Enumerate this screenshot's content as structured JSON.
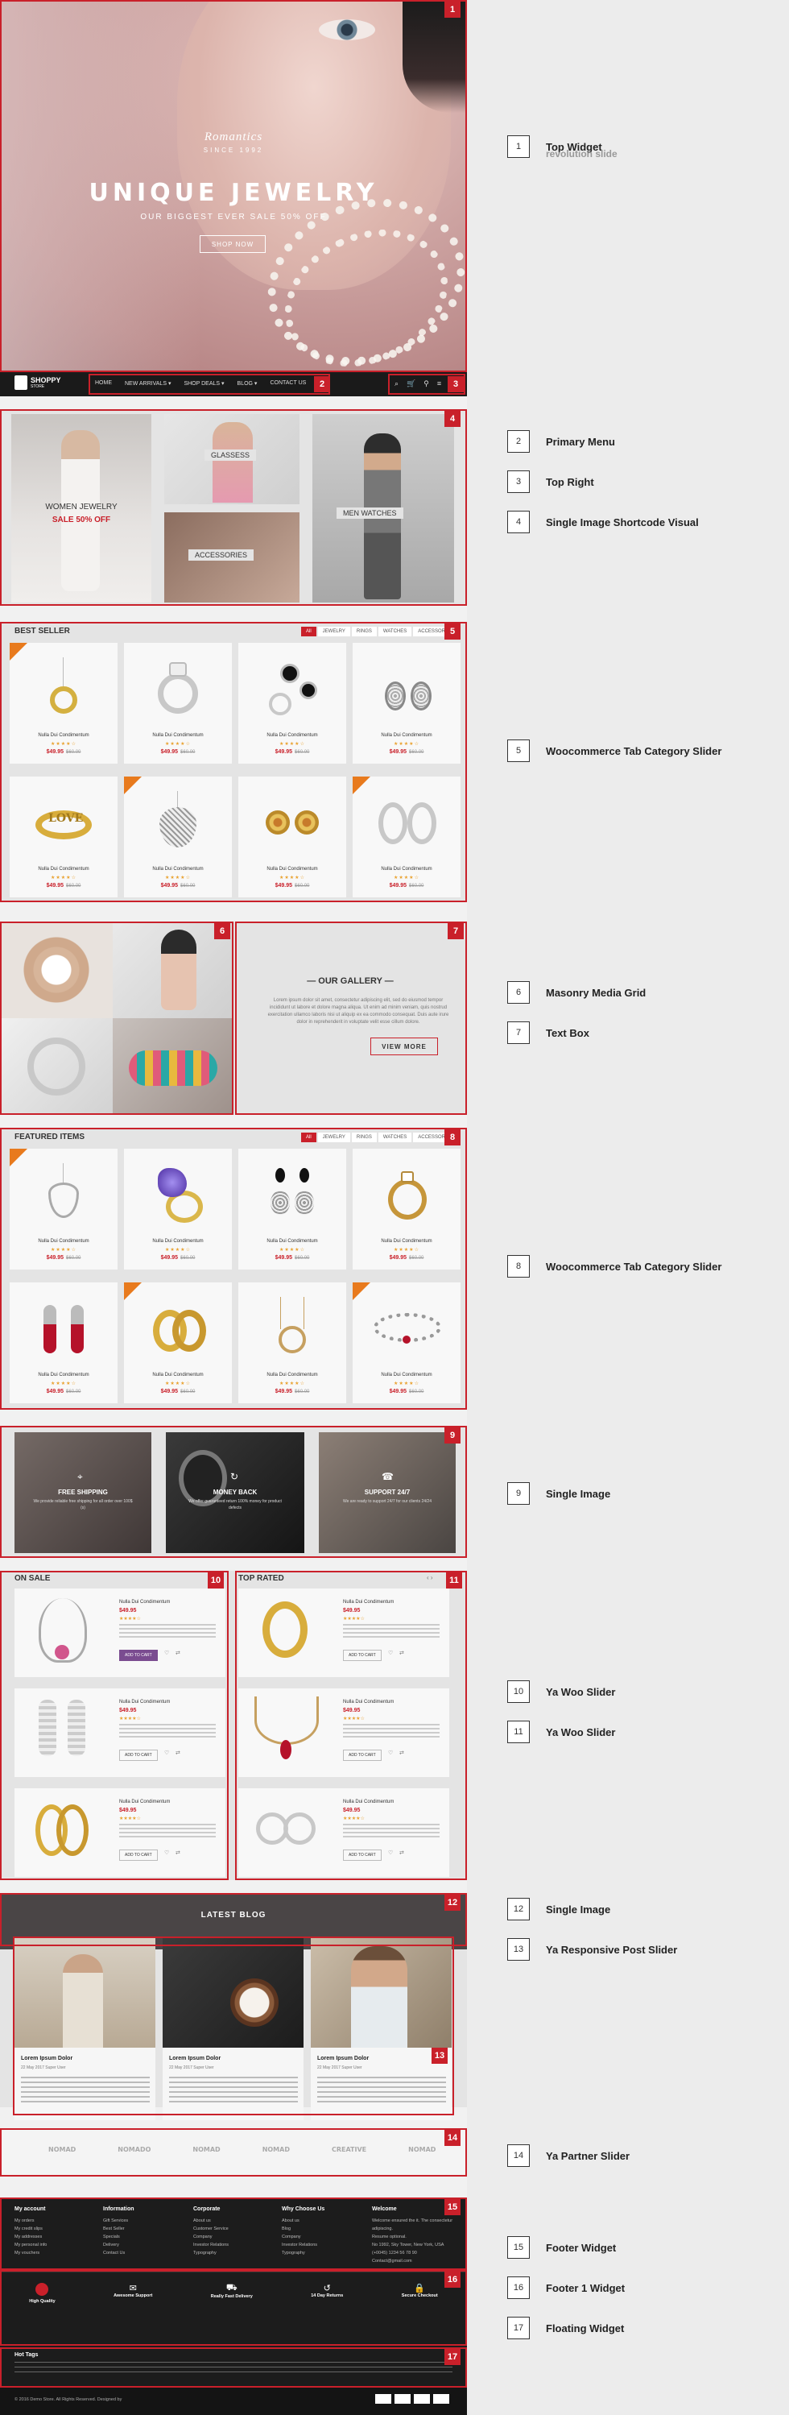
{
  "hero": {
    "script_title": "Romantics",
    "since": "SINCE 1992",
    "title": "UNIQUE JEWELRY",
    "subtitle": "OUR BIGGEST EVER SALE 50% OFF",
    "button": "SHOP NOW"
  },
  "header": {
    "logo": "SHOPPY",
    "logo_sub": "STORE",
    "nav": [
      "HOME",
      "NEW ARRIVALS ▾",
      "SHOP DEALS ▾",
      "BLOG ▾",
      "CONTACT US"
    ]
  },
  "banners": {
    "women": "WOMEN JEWELRY",
    "women_sale": "SALE 50% OFF",
    "glasses": "GLASSESS",
    "accessories": "ACCESSORIES",
    "men": "MEN WATCHES"
  },
  "bestseller": {
    "title": "BEST SELLER",
    "tabs": [
      "All",
      "JEWELRY",
      "RINGS",
      "WATCHES",
      "ACCESSORIES"
    ],
    "product_name": "Nulla Dui Condimentum",
    "stars": "★★★★☆",
    "price": "$49.95",
    "old_price": "$60.00"
  },
  "gallery": {
    "title": "OUR GALLERY",
    "text": "Lorem ipsum dolor sit amet, consectetur adipiscing elit, sed do eiusmod tempor incididunt ut labore et dolore magna aliqua. Ut enim ad minim veniam, quis nostrud exercitation ullamco laboris nisi ut aliquip ex ea commodo consequat. Duis aute irure dolor in reprehenderit in voluptate velit esse cillum dolore.",
    "button": "VIEW MORE"
  },
  "featured": {
    "title": "FEATURED ITEMS",
    "tabs": [
      "All",
      "JEWELRY",
      "RINGS",
      "WATCHES",
      "ACCESSORIES"
    ]
  },
  "services": [
    {
      "title": "FREE SHIPPING",
      "desc": "We provide reliable free shipping for all order over 100$ (s)"
    },
    {
      "title": "MONEY BACK",
      "desc": "We offer guaranteed return 100% money for product defects"
    },
    {
      "title": "SUPPORT 24/7",
      "desc": "We are ready to support 24/7 for our clients 24/24"
    }
  ],
  "onsale": {
    "title": "ON SALE",
    "add_to_cart": "ADD TO CART"
  },
  "toprated": {
    "title": "TOP RATED"
  },
  "blog": {
    "title": "LATEST BLOG",
    "post_title": "Lorem Ipsum Dolor",
    "meta": "22 May 2017   Super User"
  },
  "partners": [
    "NOMAD",
    "NOMADO",
    "NOMAD",
    "NOMAD",
    "CREATIVE",
    "NOMAD"
  ],
  "footer": {
    "cols": [
      {
        "title": "My account",
        "items": [
          "My orders",
          "My credit slips",
          "My addresses",
          "My personal info",
          "My vouchers"
        ]
      },
      {
        "title": "Information",
        "items": [
          "Gift Services",
          "Best Seller",
          "Specials",
          "Delivery",
          "Contact Us"
        ]
      },
      {
        "title": "Corporate",
        "items": [
          "About us",
          "Customer Service",
          "Company",
          "Investor Relations",
          "Typography"
        ]
      },
      {
        "title": "Why Choose Us",
        "items": [
          "About us",
          "Blog",
          "Company",
          "Investor Relations",
          "Typography"
        ]
      },
      {
        "title": "Welcome",
        "items": [
          "Welcome ensured the it. The consectetur adipiscing.",
          "Resume optional.",
          "No 1992, Sky Tower, New York, USA",
          "(+0045) 1234 56 78 90",
          "Contact@gmail.com"
        ]
      }
    ],
    "features": [
      "High Quality",
      "Awesome Support",
      "Really Fast Delivery",
      "14 Day Returns",
      "Secure Checkout"
    ],
    "hot_tags": "Hot Tags",
    "copyright": "© 2016 Demo Store. All Rights Reserved. Designed by"
  },
  "labels": [
    {
      "num": "1",
      "title": "Top Widget",
      "sub": "revolution slide"
    },
    {
      "num": "2",
      "title": "Primary Menu"
    },
    {
      "num": "3",
      "title": "Top Right"
    },
    {
      "num": "4",
      "title": "Single Image Shortcode Visual"
    },
    {
      "num": "5",
      "title": "Woocommerce Tab Category Slider"
    },
    {
      "num": "6",
      "title": "Masonry Media Grid"
    },
    {
      "num": "7",
      "title": "Text Box"
    },
    {
      "num": "8",
      "title": "Woocommerce Tab Category Slider"
    },
    {
      "num": "9",
      "title": "Single Image"
    },
    {
      "num": "10",
      "title": "Ya Woo Slider"
    },
    {
      "num": "11",
      "title": "Ya Woo Slider"
    },
    {
      "num": "12",
      "title": "Single Image"
    },
    {
      "num": "13",
      "title": "Ya Responsive Post Slider"
    },
    {
      "num": "14",
      "title": "Ya Partner Slider"
    },
    {
      "num": "15",
      "title": "Footer Widget"
    },
    {
      "num": "16",
      "title": "Footer 1 Widget"
    },
    {
      "num": "17",
      "title": "Floating Widget"
    }
  ],
  "colors": {
    "accent": "#c9202a",
    "dark": "#1a1a1a",
    "star": "#e9a12d"
  }
}
